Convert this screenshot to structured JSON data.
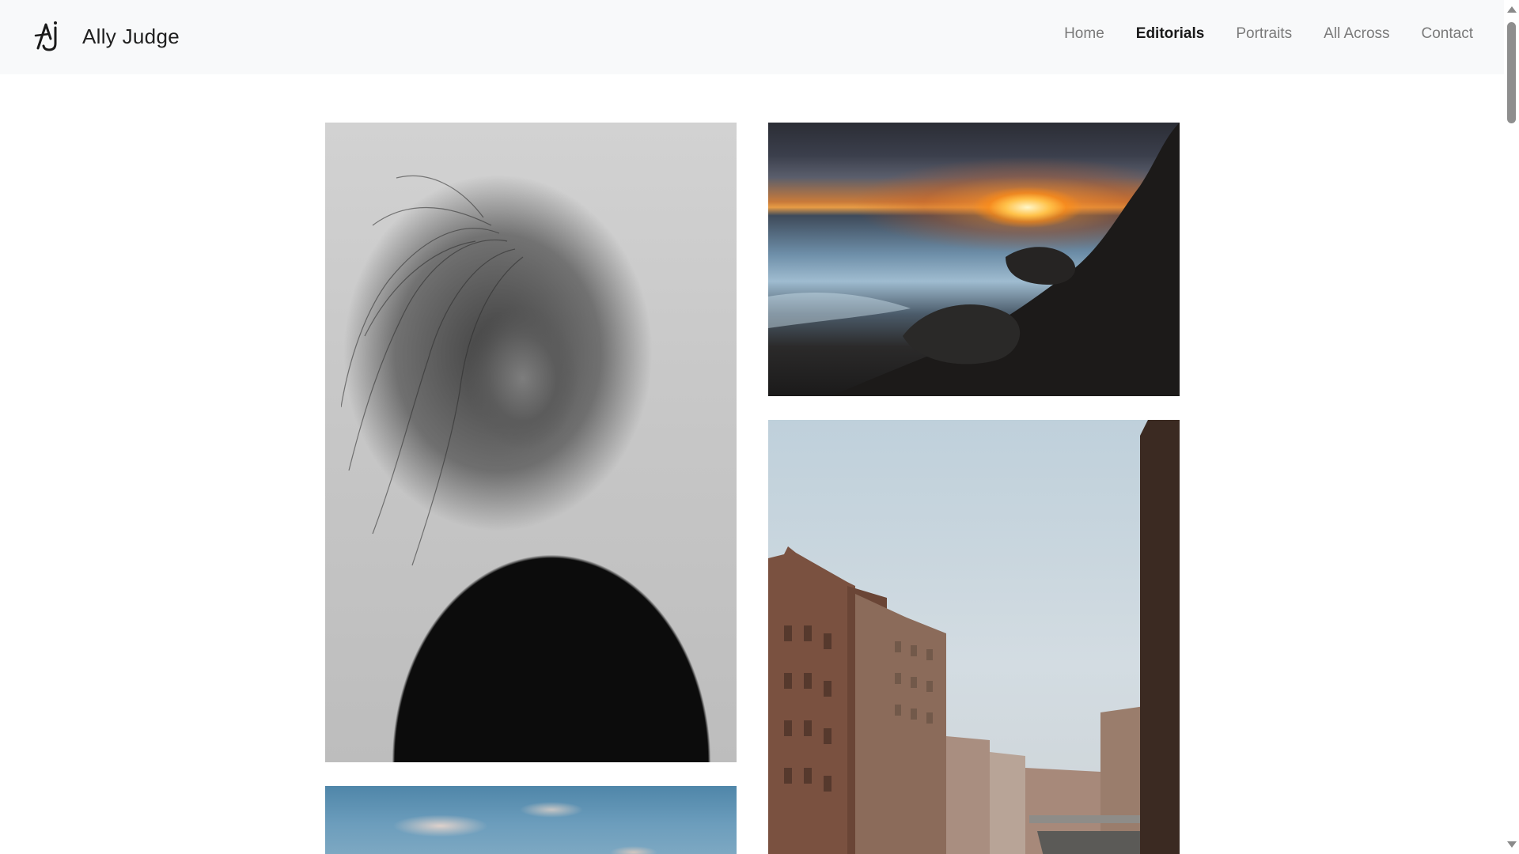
{
  "brand": {
    "logo_icon": "aj-monogram-logo-icon",
    "name": "Ally Judge"
  },
  "nav": {
    "items": [
      {
        "label": "Home",
        "active": false
      },
      {
        "label": "Editorials",
        "active": true
      },
      {
        "label": "Portraits",
        "active": false
      },
      {
        "label": "All Across",
        "active": false
      },
      {
        "label": "Contact",
        "active": false
      }
    ]
  },
  "gallery": {
    "photos": [
      {
        "subject": "bw-portrait-woman-windblown-hair"
      },
      {
        "subject": "sunset-rocky-coast"
      },
      {
        "subject": "canal-brick-warehouses"
      },
      {
        "subject": "sky-clouds"
      }
    ]
  },
  "colors": {
    "header_bg": "#f8f9fa",
    "nav_inactive": "#7a7a7a",
    "nav_active": "#1a1a1a",
    "page_bg": "#ffffff"
  }
}
